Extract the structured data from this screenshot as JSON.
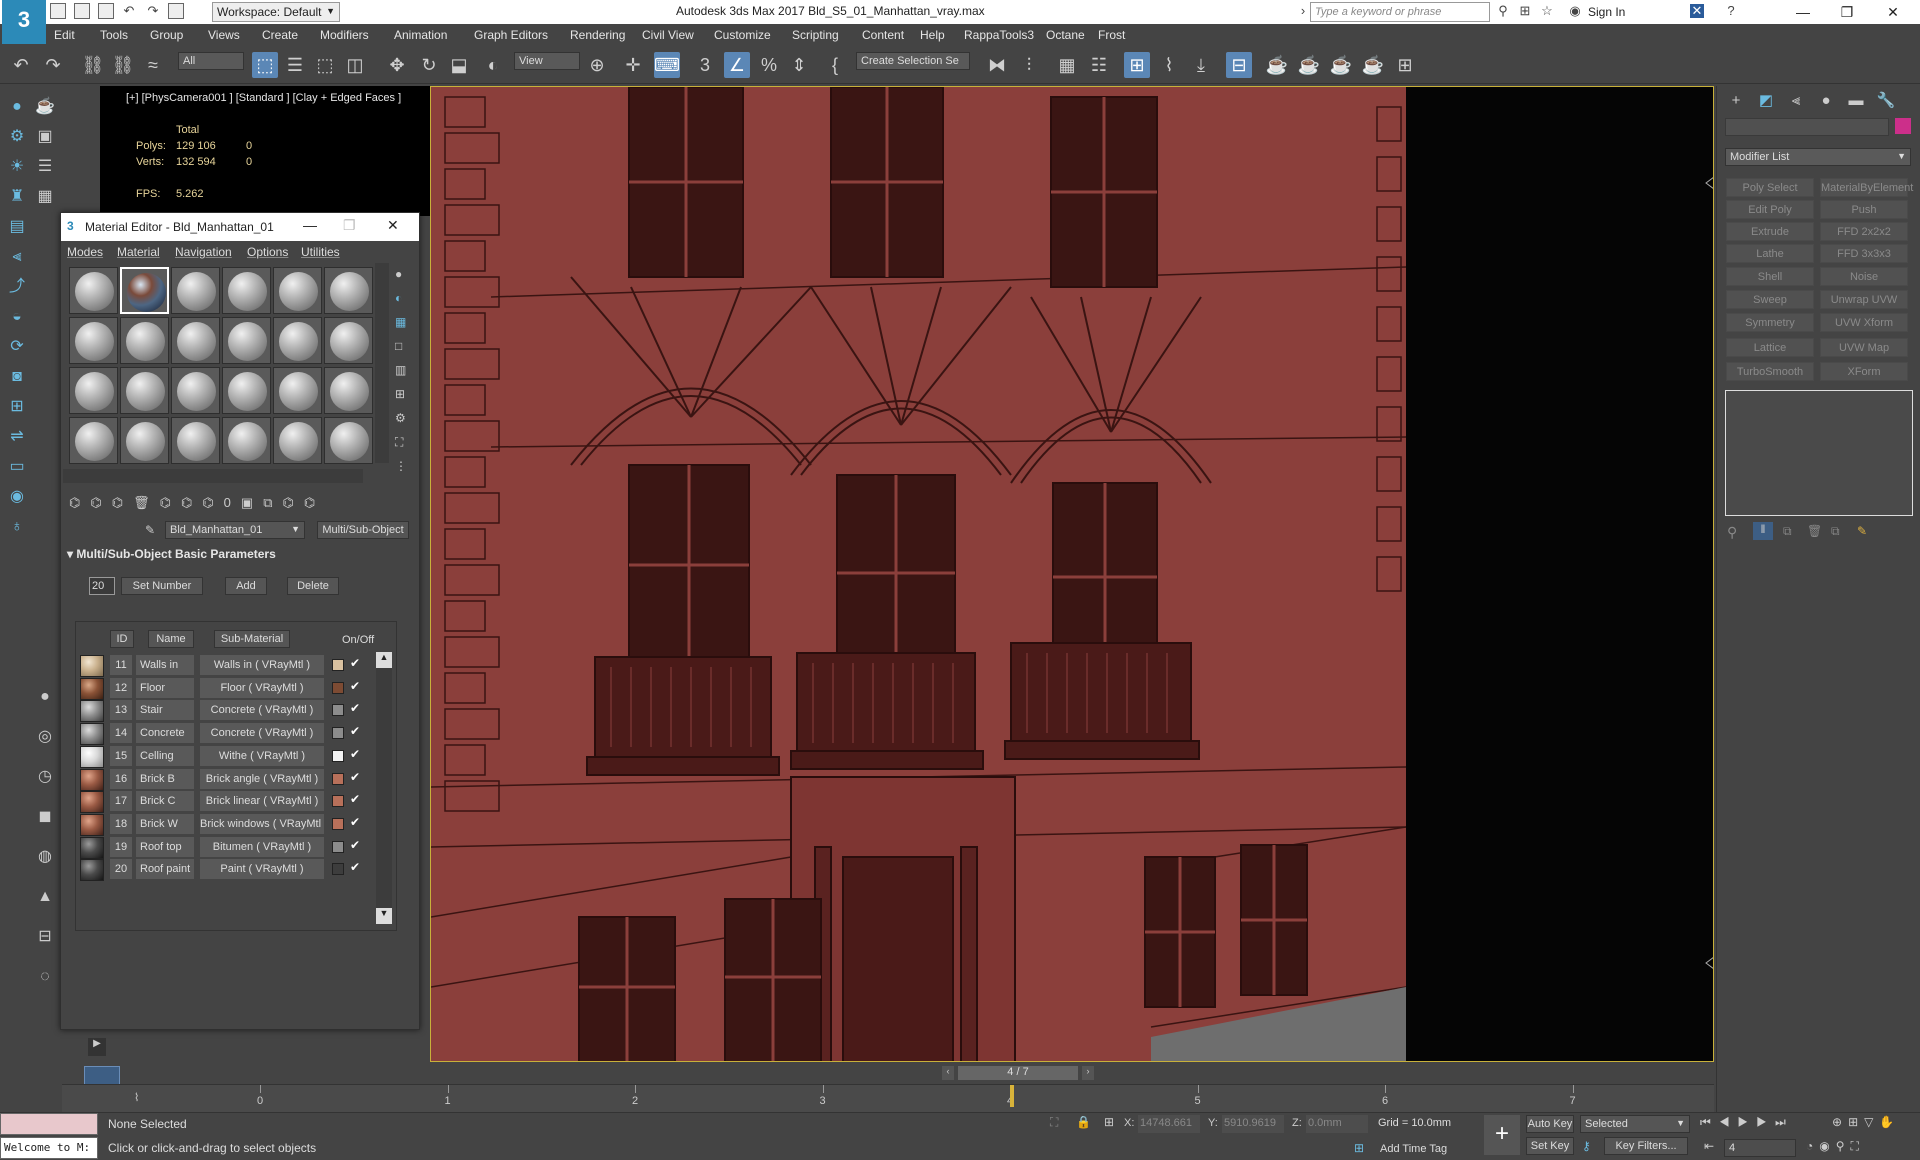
{
  "titlebar": {
    "workspace": "Workspace: Default",
    "app_title": "Autodesk 3ds Max 2017     Bld_S5_01_Manhattan_vray.max",
    "search_placeholder": "Type a keyword or phrase",
    "sign_in": "Sign In"
  },
  "menu": [
    "Edit",
    "Tools",
    "Group",
    "Views",
    "Create",
    "Modifiers",
    "Animation",
    "Graph Editors",
    "Rendering",
    "Civil View",
    "Customize",
    "Scripting",
    "Content",
    "Help",
    "RappaTools3",
    "Octane",
    "Frost"
  ],
  "toolbar": {
    "filter_select": "All",
    "ref_coord": "View",
    "selection_set": "Create Selection Se"
  },
  "viewport": {
    "label": "[+] [PhysCamera001 ] [Standard ] [Clay + Edged Faces ]",
    "stats": {
      "total_label": "Total",
      "polys_label": "Polys:",
      "polys_value": "129 106",
      "polys_sel": "0",
      "verts_label": "Verts:",
      "verts_value": "132 594",
      "verts_sel": "0",
      "fps_label": "FPS:",
      "fps_value": "5.262"
    },
    "building_color": "#8b3f3b"
  },
  "command_panel": {
    "name_field": "",
    "modifier_list": "Modifier List",
    "modifiers": [
      [
        "Poly Select",
        "MaterialByElement"
      ],
      [
        "Edit Poly",
        "Push"
      ],
      [
        "Extrude",
        "FFD 2x2x2"
      ],
      [
        "Lathe",
        "FFD 3x3x3"
      ],
      [
        "Shell",
        "Noise"
      ],
      [
        "Sweep",
        "Unwrap UVW"
      ],
      [
        "Symmetry",
        "UVW Xform"
      ],
      [
        "Lattice",
        "UVW Map"
      ],
      [
        "TurboSmooth",
        "XForm"
      ]
    ]
  },
  "material_editor": {
    "title": "Material Editor - Bld_Manhattan_01",
    "menu": [
      "Modes",
      "Material",
      "Navigation",
      "Options",
      "Utilities"
    ],
    "material_name": "Bld_Manhattan_01",
    "material_type": "Multi/Sub-Object",
    "rollout_title": "Multi/Sub-Object Basic Parameters",
    "set_number_value": "20",
    "buttons": {
      "set_number": "Set Number",
      "add": "Add",
      "delete": "Delete"
    },
    "columns": {
      "id": "ID",
      "name": "Name",
      "sub_material": "Sub-Material",
      "on_off": "On/Off"
    },
    "rows": [
      {
        "id": "11",
        "name": "Walls in",
        "sub": "Walls in  ( VRayMtl )",
        "swatch": "#b8a88a",
        "color": "#d9c1a0",
        "ball": "walls"
      },
      {
        "id": "12",
        "name": "Floor",
        "sub": "Floor  ( VRayMtl )",
        "swatch": "#7a4a32",
        "color": "#7d4b33",
        "ball": "floor"
      },
      {
        "id": "13",
        "name": "Stair",
        "sub": "Concrete  ( VRayMtl )",
        "swatch": "#8e8e8e",
        "color": "#8c8c8c",
        "ball": "grey"
      },
      {
        "id": "14",
        "name": "Concrete",
        "sub": "Concrete  ( VRayMtl )",
        "swatch": "#8e8e8e",
        "color": "#8c8c8c",
        "ball": "grey"
      },
      {
        "id": "15",
        "name": "Celling",
        "sub": "Withe  ( VRayMtl )",
        "swatch": "#e8e8e8",
        "color": "#f2f2f2",
        "ball": "white"
      },
      {
        "id": "16",
        "name": "Brick B",
        "sub": "Brick angle  ( VRayMtl )",
        "swatch": "#9a5a44",
        "color": "#b8705a",
        "ball": "brick"
      },
      {
        "id": "17",
        "name": "Brick C",
        "sub": "Brick linear  ( VRayMtl )",
        "swatch": "#9a5a44",
        "color": "#b8705a",
        "ball": "brick"
      },
      {
        "id": "18",
        "name": "Brick W",
        "sub": "Brick windows  ( VRayMtl )",
        "swatch": "#9a5a44",
        "color": "#b8705a",
        "ball": "brick"
      },
      {
        "id": "19",
        "name": "Roof top",
        "sub": "Bitumen  ( VRayMtl )",
        "swatch": "#3a3a3a",
        "color": "#8c8c8c",
        "ball": "dark"
      },
      {
        "id": "20",
        "name": "Roof paint",
        "sub": "Paint  ( VRayMtl )",
        "swatch": "#2a2a2a",
        "color": "#3d3d3d",
        "ball": "dark"
      }
    ]
  },
  "timeline": {
    "frame_counter": "4 / 7",
    "ticks": [
      "0",
      "1",
      "2",
      "3",
      "4",
      "5",
      "6",
      "7"
    ]
  },
  "status": {
    "maxscript": "Welcome to M:",
    "selection": "None Selected",
    "prompt": "Click or click-and-drag to select objects",
    "x_label": "X:",
    "x_value": "14748.661",
    "y_label": "Y:",
    "y_value": "5910.9619",
    "z_label": "Z:",
    "z_value": "0.0mm",
    "grid": "Grid = 10.0mm",
    "add_time_tag": "Add Time Tag",
    "auto_key": "Auto Key",
    "selected": "Selected",
    "set_key": "Set Key",
    "key_filters": "Key Filters...",
    "frame": "4"
  }
}
